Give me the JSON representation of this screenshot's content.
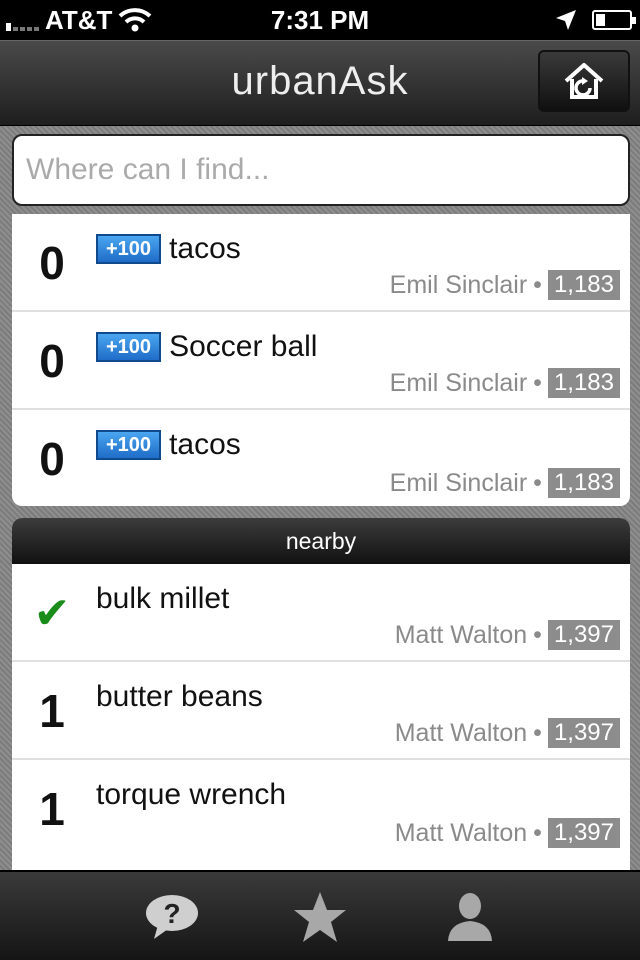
{
  "status_bar": {
    "carrier": "AT&T",
    "time": "7:31 PM"
  },
  "nav": {
    "title": "urbanAsk",
    "home_icon": "home-refresh-icon"
  },
  "search": {
    "placeholder": "Where can I find...",
    "value": ""
  },
  "questions": [
    {
      "score": "0",
      "bounty": "+100",
      "title": "tacos",
      "user": "Emil Sinclair",
      "rep": "1,183"
    },
    {
      "score": "0",
      "bounty": "+100",
      "title": "Soccer ball",
      "user": "Emil Sinclair",
      "rep": "1,183"
    },
    {
      "score": "0",
      "bounty": "+100",
      "title": "tacos",
      "user": "Emil Sinclair",
      "rep": "1,183"
    }
  ],
  "nearby": {
    "header": "nearby",
    "items": [
      {
        "score": "✔",
        "answered": true,
        "title": "bulk millet",
        "user": "Matt Walton",
        "rep": "1,397"
      },
      {
        "score": "1",
        "answered": false,
        "title": "butter beans",
        "user": "Matt Walton",
        "rep": "1,397"
      },
      {
        "score": "1",
        "answered": false,
        "title": "torque wrench",
        "user": "Matt Walton",
        "rep": "1,397"
      }
    ]
  },
  "tabs": [
    {
      "icon": "question-bubble-icon"
    },
    {
      "icon": "star-icon"
    },
    {
      "icon": "person-icon"
    }
  ],
  "colors": {
    "bounty": "#2a7fd8",
    "check": "#1a8c1a",
    "rep_badge": "#8c8c8c"
  }
}
